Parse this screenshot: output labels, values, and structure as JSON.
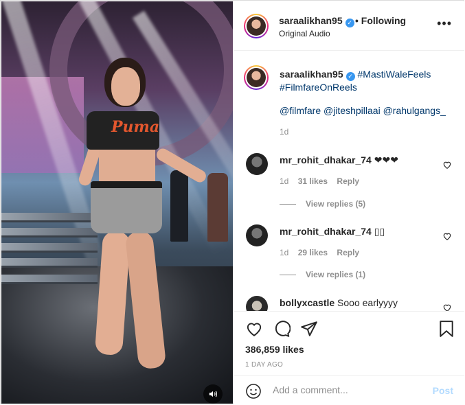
{
  "header": {
    "username": "saraalikhan95",
    "follow_label": "• Following",
    "audio_label": "Original Audio",
    "more_icon": "more-horizontal-icon"
  },
  "caption": {
    "username": "saraalikhan95",
    "hashtags_line1": "#MastiWaleFeels",
    "hashtags_line2": "#FilmfareOnReels",
    "mentions": "@filmfare @jiteshpillaai @rahulgangs_",
    "time": "1d"
  },
  "comments": [
    {
      "username": "mr_rohit_dhakar_74",
      "text": "❤❤❤",
      "time": "1d",
      "likes": "31 likes",
      "reply_label": "Reply",
      "view_replies": "View replies (5)"
    },
    {
      "username": "mr_rohit_dhakar_74",
      "text": "▯▯",
      "time": "1d",
      "likes": "29 likes",
      "reply_label": "Reply",
      "view_replies": "View replies (1)"
    },
    {
      "username": "bollyxcastle",
      "text": "Sooo earlyyyy"
    }
  ],
  "actions": {
    "likes": "386,859 likes",
    "posted": "1 DAY AGO"
  },
  "add_comment": {
    "placeholder": "Add a comment...",
    "post_label": "Post"
  },
  "media": {
    "shirt_logo": "Puma"
  },
  "colors": {
    "link": "#00376b",
    "verified": "#3897f0",
    "secondary_text": "#8e8e8e",
    "post_disabled": "#b3dbff"
  }
}
